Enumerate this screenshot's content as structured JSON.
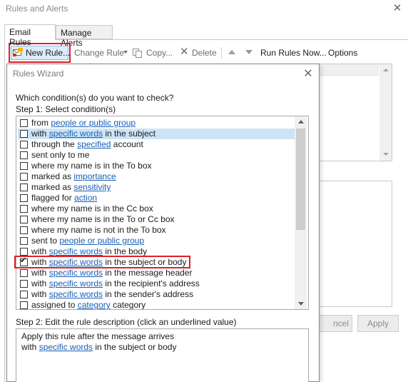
{
  "window": {
    "title": "Rules and Alerts",
    "close_glyph": "✕"
  },
  "tabs": [
    {
      "label": "Email Rules"
    },
    {
      "label": "Manage Alerts"
    }
  ],
  "toolbar": {
    "new_rule": "New Rule...",
    "change_rule": "Change Rule",
    "copy": "Copy...",
    "delete": "Delete",
    "delete_glyph": "✕",
    "run_rules": "Run Rules Now...",
    "options": "Options"
  },
  "outer_buttons": {
    "cancel": "ncel",
    "apply": "Apply"
  },
  "wizard": {
    "title": "Rules Wizard",
    "close_glyph": "✕",
    "question": "Which condition(s) do you want to check?",
    "step1": "Step 1: Select condition(s)",
    "conditions": [
      {
        "pre": "from ",
        "link": "people or public group",
        "post": "",
        "checked": false
      },
      {
        "pre": "with ",
        "link": "specific words",
        "post": " in the subject",
        "checked": false
      },
      {
        "pre": "through the ",
        "link": "specified",
        "post": " account",
        "checked": false
      },
      {
        "pre": "sent only to me",
        "link": "",
        "post": "",
        "checked": false
      },
      {
        "pre": "where my name is in the To box",
        "link": "",
        "post": "",
        "checked": false
      },
      {
        "pre": "marked as ",
        "link": "importance",
        "post": "",
        "checked": false
      },
      {
        "pre": "marked as ",
        "link": "sensitivity",
        "post": "",
        "checked": false
      },
      {
        "pre": "flagged for ",
        "link": "action",
        "post": "",
        "checked": false
      },
      {
        "pre": "where my name is in the Cc box",
        "link": "",
        "post": "",
        "checked": false
      },
      {
        "pre": "where my name is in the To or Cc box",
        "link": "",
        "post": "",
        "checked": false
      },
      {
        "pre": "where my name is not in the To box",
        "link": "",
        "post": "",
        "checked": false
      },
      {
        "pre": "sent to ",
        "link": "people or public group",
        "post": "",
        "checked": false
      },
      {
        "pre": "with ",
        "link": "specific words",
        "post": " in the body",
        "checked": false
      },
      {
        "pre": "with ",
        "link": "specific words",
        "post": " in the subject or body",
        "checked": true
      },
      {
        "pre": "with ",
        "link": "specific words",
        "post": " in the message header",
        "checked": false
      },
      {
        "pre": "with ",
        "link": "specific words",
        "post": " in the recipient's address",
        "checked": false
      },
      {
        "pre": "with ",
        "link": "specific words",
        "post": " in the sender's address",
        "checked": false
      },
      {
        "pre": "assigned to ",
        "link": "category",
        "post": " category",
        "checked": false
      }
    ],
    "selected_index": 1,
    "check_glyph": "✔",
    "step2": "Step 2: Edit the rule description (click an underlined value)",
    "description": {
      "line1": "Apply this rule after the message arrives",
      "line2_pre": "with ",
      "line2_link": "specific words",
      "line2_post": " in the subject or body"
    }
  }
}
